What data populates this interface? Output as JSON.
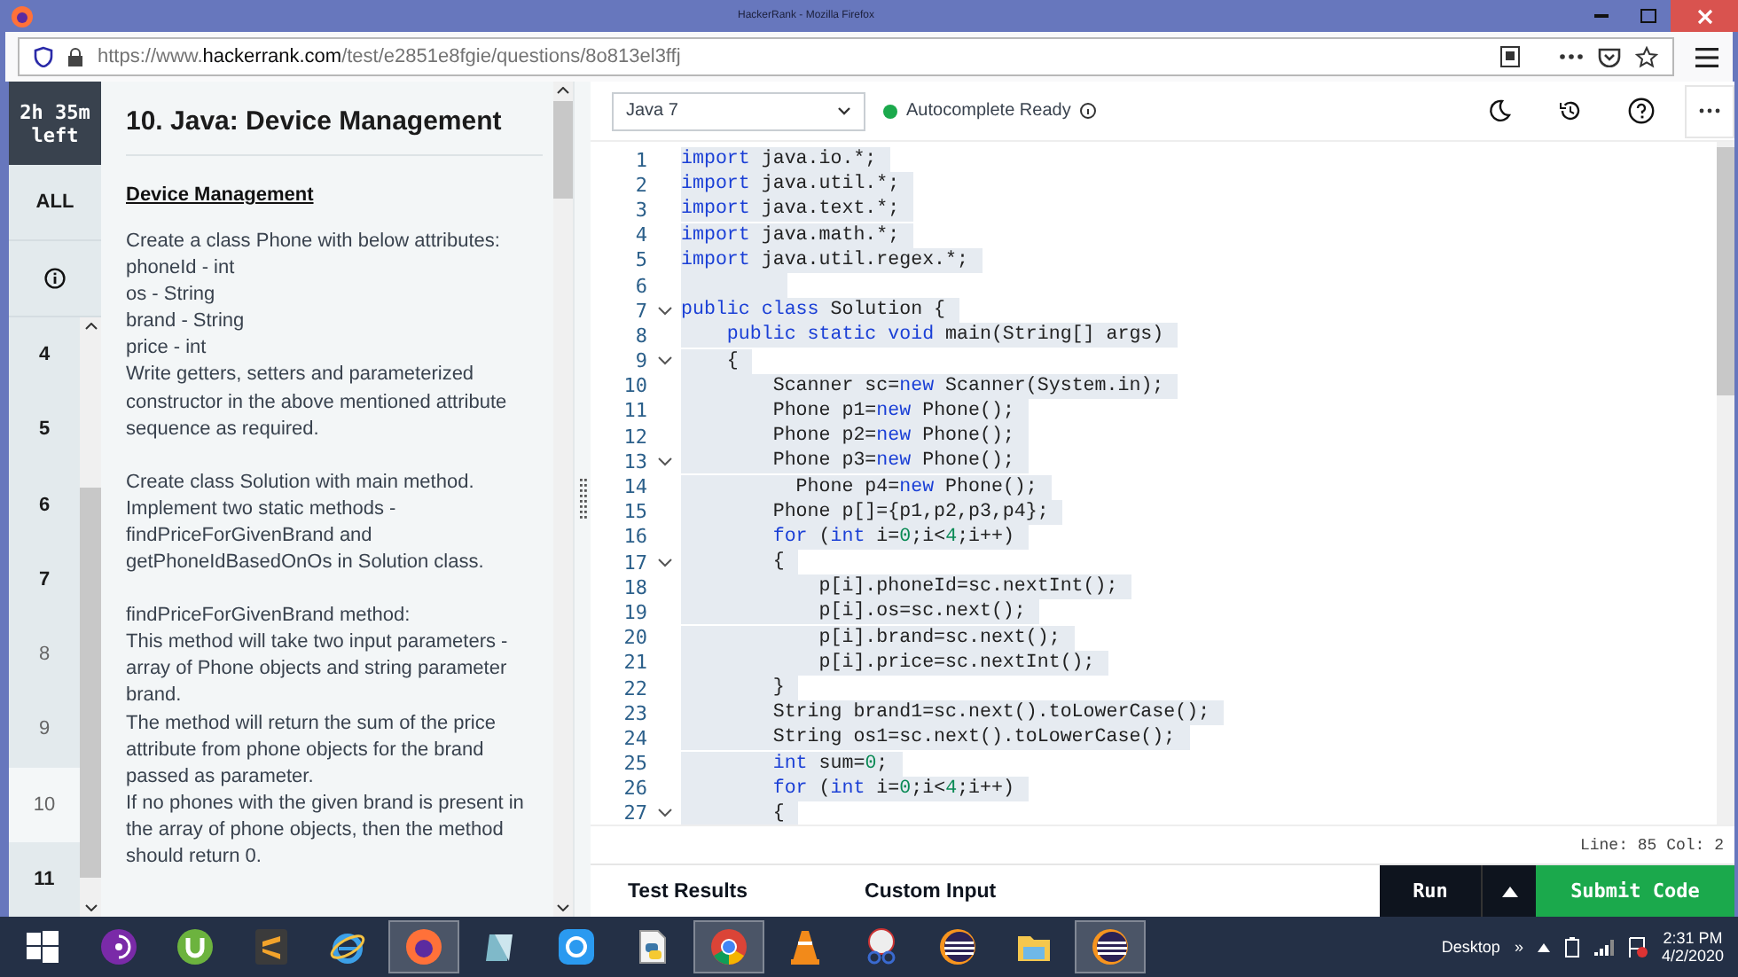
{
  "window": {
    "title": "HackerRank - Mozilla Firefox"
  },
  "address_bar": {
    "url_start": "https://www.",
    "url_host": "hackerrank.com",
    "url_path": "/test/e2851e8fgie/questions/8o813el3ffj"
  },
  "timer": {
    "line_1": "2h 35m",
    "line_2": "left"
  },
  "question_nav": {
    "all_label": "ALL",
    "items": [
      {
        "label": "4",
        "selected": false,
        "attempted": true
      },
      {
        "label": "5",
        "selected": false,
        "attempted": true
      },
      {
        "label": "6",
        "selected": false,
        "attempted": true
      },
      {
        "label": "7",
        "selected": false,
        "attempted": true
      },
      {
        "label": "8",
        "selected": false,
        "attempted": false
      },
      {
        "label": "9",
        "selected": false,
        "attempted": false
      },
      {
        "label": "10",
        "selected": true,
        "attempted": false
      },
      {
        "label": "11",
        "selected": false,
        "attempted": true
      }
    ]
  },
  "question": {
    "title": "10. Java: Device Management",
    "heading": "Device Management",
    "paragraphs": [
      [
        "Create a class Phone with below attributes:",
        "phoneId - int",
        "os - String",
        "brand - String",
        "price - int",
        "Write getters, setters and parameterized",
        "constructor in the above mentioned attribute",
        "sequence as required."
      ],
      [
        "Create class Solution with main method.",
        "Implement two static methods -",
        "findPriceForGivenBrand and",
        "getPhoneIdBasedOnOs in Solution class."
      ],
      [
        "findPriceForGivenBrand method:",
        "This method will take two input parameters -",
        "array of Phone objects and string parameter",
        "brand.",
        "The method will return the sum of the price",
        "attribute from phone objects for the brand",
        "passed as parameter.",
        "If no phones with the given brand is present in",
        "the array of phone objects, then the method",
        "should return 0."
      ]
    ]
  },
  "editor": {
    "language": "Java 7",
    "autocomplete_status": "Autocomplete Ready",
    "autocomplete_ready": true,
    "lines": [
      {
        "number": "1",
        "fold": false,
        "tokens": [
          {
            "kind": "keyword",
            "text": "import"
          },
          {
            "kind": "plain",
            "text": " java.io.*;"
          }
        ]
      },
      {
        "number": "2",
        "fold": false,
        "tokens": [
          {
            "kind": "keyword",
            "text": "import"
          },
          {
            "kind": "plain",
            "text": " java.util.*;"
          }
        ]
      },
      {
        "number": "3",
        "fold": false,
        "tokens": [
          {
            "kind": "keyword",
            "text": "import"
          },
          {
            "kind": "plain",
            "text": " java.text.*;"
          }
        ]
      },
      {
        "number": "4",
        "fold": false,
        "tokens": [
          {
            "kind": "keyword",
            "text": "import"
          },
          {
            "kind": "plain",
            "text": " java.math.*;"
          }
        ]
      },
      {
        "number": "5",
        "fold": false,
        "tokens": [
          {
            "kind": "keyword",
            "text": "import"
          },
          {
            "kind": "plain",
            "text": " java.util.regex.*;"
          }
        ]
      },
      {
        "number": "6",
        "fold": false
      },
      {
        "number": "7",
        "fold": true,
        "tokens": [
          {
            "kind": "keyword",
            "text": "public class"
          },
          {
            "kind": "plain",
            "text": " Solution {"
          }
        ]
      },
      {
        "number": "8",
        "fold": false,
        "tokens": [
          {
            "kind": "keyword",
            "text": "    public static void"
          },
          {
            "kind": "plain",
            "text": " main(String[] args)"
          }
        ]
      },
      {
        "number": "9",
        "fold": true,
        "tokens": [
          {
            "kind": "plain",
            "text": "    {"
          }
        ]
      },
      {
        "number": "10",
        "fold": false,
        "tokens": [
          {
            "kind": "plain",
            "text": "        Scanner sc="
          },
          {
            "kind": "keyword",
            "text": "new"
          },
          {
            "kind": "plain",
            "text": " Scanner(System.in);"
          }
        ]
      },
      {
        "number": "11",
        "fold": false,
        "tokens": [
          {
            "kind": "plain",
            "text": "        Phone p1="
          },
          {
            "kind": "keyword",
            "text": "new"
          },
          {
            "kind": "plain",
            "text": " Phone();"
          }
        ]
      },
      {
        "number": "12",
        "fold": false,
        "tokens": [
          {
            "kind": "plain",
            "text": "        Phone p2="
          },
          {
            "kind": "keyword",
            "text": "new"
          },
          {
            "kind": "plain",
            "text": " Phone();"
          }
        ]
      },
      {
        "number": "13",
        "fold": true,
        "tokens": [
          {
            "kind": "plain",
            "text": "        Phone p3="
          },
          {
            "kind": "keyword",
            "text": "new"
          },
          {
            "kind": "plain",
            "text": " Phone();"
          }
        ]
      },
      {
        "number": "14",
        "fold": false,
        "tokens": [
          {
            "kind": "plain",
            "text": "          Phone p4="
          },
          {
            "kind": "keyword",
            "text": "new"
          },
          {
            "kind": "plain",
            "text": " Phone();"
          }
        ]
      },
      {
        "number": "15",
        "fold": false,
        "tokens": [
          {
            "kind": "plain",
            "text": "        Phone p[]={p1,p2,p3,p4};"
          }
        ]
      },
      {
        "number": "16",
        "fold": false,
        "tokens": [
          {
            "kind": "keyword",
            "text": "        for"
          },
          {
            "kind": "plain",
            "text": " ("
          },
          {
            "kind": "keyword",
            "text": "int"
          },
          {
            "kind": "plain",
            "text": " i="
          },
          {
            "kind": "number",
            "text": "0"
          },
          {
            "kind": "plain",
            "text": ";i<"
          },
          {
            "kind": "number",
            "text": "4"
          },
          {
            "kind": "plain",
            "text": ";i++)"
          }
        ]
      },
      {
        "number": "17",
        "fold": true,
        "tokens": [
          {
            "kind": "plain",
            "text": "        {"
          }
        ]
      },
      {
        "number": "18",
        "fold": false,
        "tokens": [
          {
            "kind": "plain",
            "text": "            p[i].phoneId=sc.nextInt();"
          }
        ]
      },
      {
        "number": "19",
        "fold": false,
        "tokens": [
          {
            "kind": "plain",
            "text": "            p[i].os=sc.next();"
          }
        ]
      },
      {
        "number": "20",
        "fold": false,
        "tokens": [
          {
            "kind": "plain",
            "text": "            p[i].brand=sc.next();"
          }
        ]
      },
      {
        "number": "21",
        "fold": false,
        "tokens": [
          {
            "kind": "plain",
            "text": "            p[i].price=sc.nextInt();"
          }
        ]
      },
      {
        "number": "22",
        "fold": false,
        "tokens": [
          {
            "kind": "plain",
            "text": "        }"
          }
        ]
      },
      {
        "number": "23",
        "fold": false,
        "tokens": [
          {
            "kind": "plain",
            "text": "        String brand1=sc.next().toLowerCase();"
          }
        ]
      },
      {
        "number": "24",
        "fold": false,
        "tokens": [
          {
            "kind": "plain",
            "text": "        String os1=sc.next().toLowerCase();"
          }
        ]
      },
      {
        "number": "25",
        "fold": false,
        "tokens": [
          {
            "kind": "keyword",
            "text": "        int"
          },
          {
            "kind": "plain",
            "text": " sum="
          },
          {
            "kind": "number",
            "text": "0"
          },
          {
            "kind": "plain",
            "text": ";"
          }
        ]
      },
      {
        "number": "26",
        "fold": false,
        "tokens": [
          {
            "kind": "keyword",
            "text": "        for"
          },
          {
            "kind": "plain",
            "text": " ("
          },
          {
            "kind": "keyword",
            "text": "int"
          },
          {
            "kind": "plain",
            "text": " i="
          },
          {
            "kind": "number",
            "text": "0"
          },
          {
            "kind": "plain",
            "text": ";i<"
          },
          {
            "kind": "number",
            "text": "4"
          },
          {
            "kind": "plain",
            "text": ";i++)"
          }
        ]
      },
      {
        "number": "27",
        "fold": true,
        "tokens": [
          {
            "kind": "plain",
            "text": "        {"
          }
        ]
      }
    ],
    "cursor_position": "Line: 85 Col: 2"
  },
  "bottom_bar": {
    "tabs": [
      {
        "label": "Test Results",
        "selected": false
      },
      {
        "label": "Custom Input",
        "selected": false
      }
    ],
    "run_label": "Run",
    "submit_label": "Submit Code"
  },
  "taskbar": {
    "apps": [
      {
        "kind": "start",
        "active": false
      },
      {
        "kind": "tor",
        "active": false
      },
      {
        "kind": "utorrent",
        "active": false
      },
      {
        "kind": "sublime",
        "active": false
      },
      {
        "kind": "ie",
        "active": false
      },
      {
        "kind": "firefox",
        "active": true
      },
      {
        "kind": "notepad",
        "active": false
      },
      {
        "kind": "shareit",
        "active": false
      },
      {
        "kind": "python",
        "active": false
      },
      {
        "kind": "chrome",
        "active": true
      },
      {
        "kind": "vlc",
        "active": false
      },
      {
        "kind": "snip",
        "active": false
      },
      {
        "kind": "eclipse",
        "active": false
      },
      {
        "kind": "folder",
        "active": false
      },
      {
        "kind": "eclipse",
        "active": true
      }
    ],
    "desktop_label": "Desktop",
    "toolbar_chevron": "»",
    "time": "2:31 PM",
    "date": "4/2/2020"
  }
}
